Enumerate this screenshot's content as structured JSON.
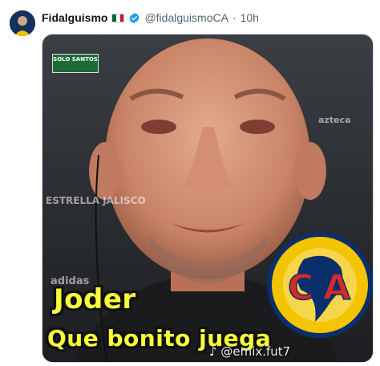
{
  "author": {
    "display_name": "Fidalguismo",
    "handle": "@fidalguismoCA",
    "time_ago": "10h",
    "separator": "·",
    "flag_icon": "mexico-flag-icon",
    "verified_icon": "verified-badge-icon",
    "verified_color": "#1d9bf0"
  },
  "media": {
    "caption_line_1": "Joder",
    "caption_line_2": "Que bonito juega",
    "watermark": "@emix.fut7",
    "watermark_icon": "tiktok-icon",
    "badge_text": "SOLO SANTOS",
    "backdrop_labels": [
      "ESTRELLA JALISCO",
      "adidas",
      "azteca"
    ],
    "club_crest_letters": "C A",
    "caption_color": "#f6ff3a",
    "crest_colors": {
      "yellow": "#f4c400",
      "blue": "#0a2f6b",
      "red": "#d42a2a"
    }
  }
}
